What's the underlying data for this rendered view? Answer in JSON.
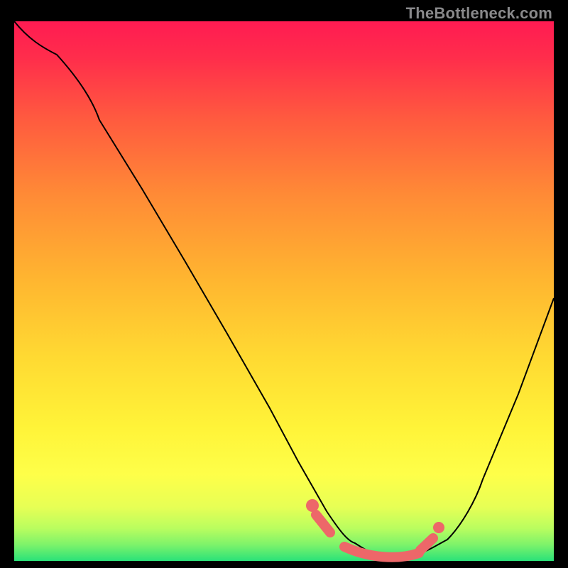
{
  "watermark": "TheBottleneck.com",
  "chart_data": {
    "type": "line",
    "title": "",
    "xlabel": "",
    "ylabel": "",
    "xlim": [
      0,
      100
    ],
    "ylim": [
      0,
      100
    ],
    "grid": false,
    "legend": false,
    "background_gradient": {
      "top_color": "#ff1b52",
      "mid_color": "#ffd932",
      "bottom_color": "#2ae279"
    },
    "series": [
      {
        "name": "bottleneck-curve",
        "color": "#000000",
        "x": [
          0.0,
          3.0,
          7.9,
          15.8,
          23.7,
          31.6,
          39.5,
          47.4,
          52.6,
          57.9,
          63.2,
          68.4,
          73.7,
          80.3,
          86.8,
          93.4,
          100.0
        ],
        "y": [
          100.0,
          97.0,
          93.8,
          81.7,
          68.9,
          55.6,
          42.1,
          28.3,
          18.4,
          9.2,
          3.3,
          0.7,
          0.7,
          3.9,
          15.1,
          30.9,
          48.7
        ]
      }
    ],
    "markers": {
      "name": "highlighted-optimal-region",
      "color": "#ed6769",
      "x": [
        51.3,
        56.0,
        60.7,
        65.3,
        70.0,
        74.7,
        78.0
      ],
      "y": [
        8.0,
        3.5,
        1.3,
        0.8,
        0.9,
        2.0,
        5.3
      ]
    }
  }
}
